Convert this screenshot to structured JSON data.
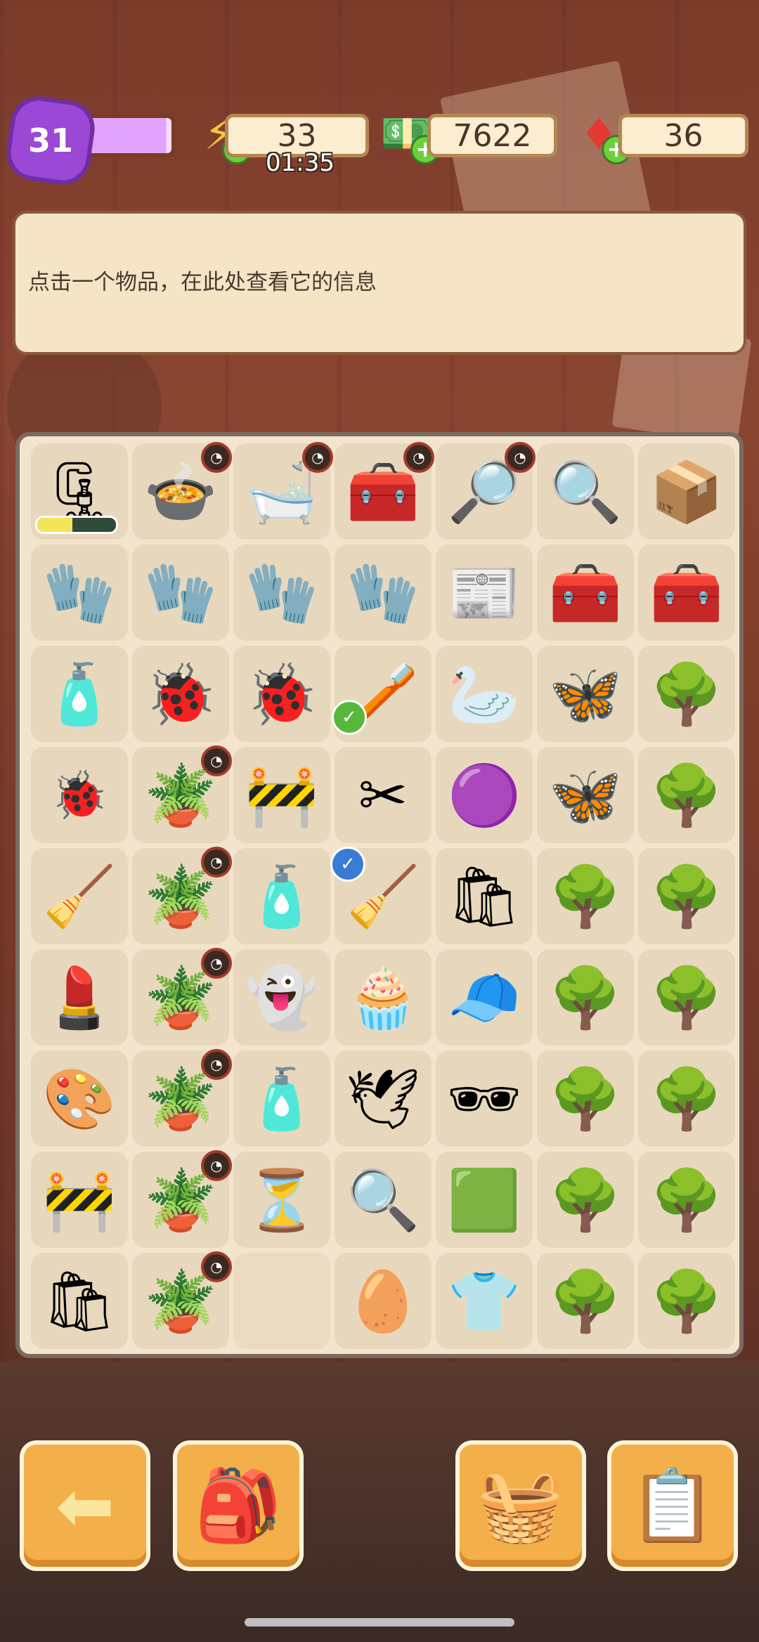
{
  "top": {
    "level": "31",
    "level_progress": 0.95,
    "energy": "33",
    "energy_timer": "01:35",
    "cash": "7622",
    "gems": "36",
    "colors": {
      "level_fill": "#9b48d6",
      "energy_icon": "#f6c640",
      "cash_icon": "#4caf50",
      "gem_icon": "#e53935",
      "plus": "#6ccf3c"
    }
  },
  "info_panel": {
    "text": "点击一个物品，在此处查看它的信息"
  },
  "board": {
    "rows": [
      [
        {
          "icon": "pliers-tool-icon",
          "glyph": "🗜",
          "progress": 0.45
        },
        {
          "icon": "gold-cooking-pot-icon",
          "glyph": "🍲",
          "timer": true
        },
        {
          "icon": "gold-water-tub-icon",
          "glyph": "🛁",
          "timer": true
        },
        {
          "icon": "green-gold-chest-icon",
          "glyph": "🧰",
          "timer": true
        },
        {
          "icon": "crime-scene-tub-icon",
          "glyph": "🔎",
          "timer": true
        },
        {
          "icon": "crime-scene-bench-icon",
          "glyph": "🔍"
        },
        {
          "icon": "crime-scene-box-icon",
          "glyph": "📦"
        }
      ],
      [
        {
          "icon": "red-white-gloves-icon",
          "glyph": "🧤"
        },
        {
          "icon": "red-gloves-icon",
          "glyph": "🧤"
        },
        {
          "icon": "red-gloves-icon",
          "glyph": "🧤"
        },
        {
          "icon": "red-gloves-icon",
          "glyph": "🧤"
        },
        {
          "icon": "price-flyer-icon",
          "glyph": "📰"
        },
        {
          "icon": "red-toolbox-icon",
          "glyph": "🧰"
        },
        {
          "icon": "red-open-toolbox-icon",
          "glyph": "🧰"
        }
      ],
      [
        {
          "icon": "soap-bottle-icon",
          "glyph": "🧴"
        },
        {
          "icon": "ladybug-pair-icon",
          "glyph": "🐞"
        },
        {
          "icon": "ladybug-pair-icon",
          "glyph": "🐞"
        },
        {
          "icon": "green-brush-icon",
          "glyph": "🪥",
          "check": "green"
        },
        {
          "icon": "white-swan-icon",
          "glyph": "🦢"
        },
        {
          "icon": "purple-moth-icon",
          "glyph": "🦋"
        },
        {
          "icon": "white-flower-tree-icon",
          "glyph": "🌳"
        }
      ],
      [
        {
          "icon": "small-ladybug-icon",
          "glyph": "🐞",
          "small": true
        },
        {
          "icon": "potted-tree-icon",
          "glyph": "🪴",
          "timer": true
        },
        {
          "icon": "caution-barrier-icon",
          "glyph": "🚧"
        },
        {
          "icon": "red-pruning-shears-icon",
          "glyph": "✂"
        },
        {
          "icon": "purple-slime-icon",
          "glyph": "🟣"
        },
        {
          "icon": "purple-moth-icon",
          "glyph": "🦋"
        },
        {
          "icon": "white-flower-tree-icon",
          "glyph": "🌳"
        }
      ],
      [
        {
          "icon": "red-broom-icon",
          "glyph": "🧹"
        },
        {
          "icon": "potted-tree-icon",
          "glyph": "🪴",
          "timer": true
        },
        {
          "icon": "pink-tube-icon",
          "glyph": "🧴"
        },
        {
          "icon": "green-broom-icon",
          "glyph": "🧹",
          "check": "blue"
        },
        {
          "icon": "evidence-bag-icon",
          "glyph": "🛍"
        },
        {
          "icon": "white-flower-tree-icon",
          "glyph": "🌳"
        },
        {
          "icon": "white-flower-tree-icon",
          "glyph": "🌳"
        }
      ],
      [
        {
          "icon": "pink-lipstick-icon",
          "glyph": "💄"
        },
        {
          "icon": "potted-tree-icon",
          "glyph": "🪴",
          "timer": true
        },
        {
          "icon": "ghost-icon",
          "glyph": "👻"
        },
        {
          "icon": "powder-puff-icon",
          "glyph": "🧁"
        },
        {
          "icon": "green-cap-icon",
          "glyph": "🧢"
        },
        {
          "icon": "white-flower-tree-icon",
          "glyph": "🌳"
        },
        {
          "icon": "white-flower-tree-icon",
          "glyph": "🌳"
        }
      ],
      [
        {
          "icon": "eyeshadow-palette-icon",
          "glyph": "🎨"
        },
        {
          "icon": "potted-tree-icon",
          "glyph": "🪴",
          "timer": true
        },
        {
          "icon": "sunscreen-bottle-icon",
          "glyph": "🧴"
        },
        {
          "icon": "white-bird-icon",
          "glyph": "🕊"
        },
        {
          "icon": "sunglasses-icon",
          "glyph": "🕶"
        },
        {
          "icon": "white-flower-tree-icon",
          "glyph": "🌳"
        },
        {
          "icon": "white-flower-tree-icon",
          "glyph": "🌳"
        }
      ],
      [
        {
          "icon": "warning-barrier-icon",
          "glyph": "🚧"
        },
        {
          "icon": "potted-tree-icon",
          "glyph": "🪴",
          "timer": true
        },
        {
          "icon": "hourglass-icon",
          "glyph": "⏳"
        },
        {
          "icon": "magnifying-glass-icon",
          "glyph": "🔍"
        },
        {
          "icon": "green-pillow-icon",
          "glyph": "🟩"
        },
        {
          "icon": "white-flower-tree-icon",
          "glyph": "🌳"
        },
        {
          "icon": "white-flower-tree-icon",
          "glyph": "🌳"
        }
      ],
      [
        {
          "icon": "evidence-bag-icon",
          "glyph": "🛍"
        },
        {
          "icon": "potted-tree-icon",
          "glyph": "🪴",
          "timer": true
        },
        {
          "icon": "",
          "glyph": "",
          "empty": true
        },
        {
          "icon": "hatching-egg-icon",
          "glyph": "🥚"
        },
        {
          "icon": "green-cloth-icon",
          "glyph": "👕"
        },
        {
          "icon": "white-flower-tree-icon",
          "glyph": "🌳"
        },
        {
          "icon": "white-flower-tree-icon",
          "glyph": "🌳"
        }
      ]
    ]
  },
  "bottom_buttons": [
    {
      "id": "back",
      "icon": "back-arrow-icon",
      "glyph": "⬅"
    },
    {
      "id": "bag",
      "icon": "backpack-icon",
      "glyph": "🎒"
    },
    {
      "id": "basket",
      "icon": "basket-icon",
      "glyph": "🧺"
    },
    {
      "id": "clipboard",
      "icon": "star-clipboard-icon",
      "glyph": "📋"
    }
  ]
}
